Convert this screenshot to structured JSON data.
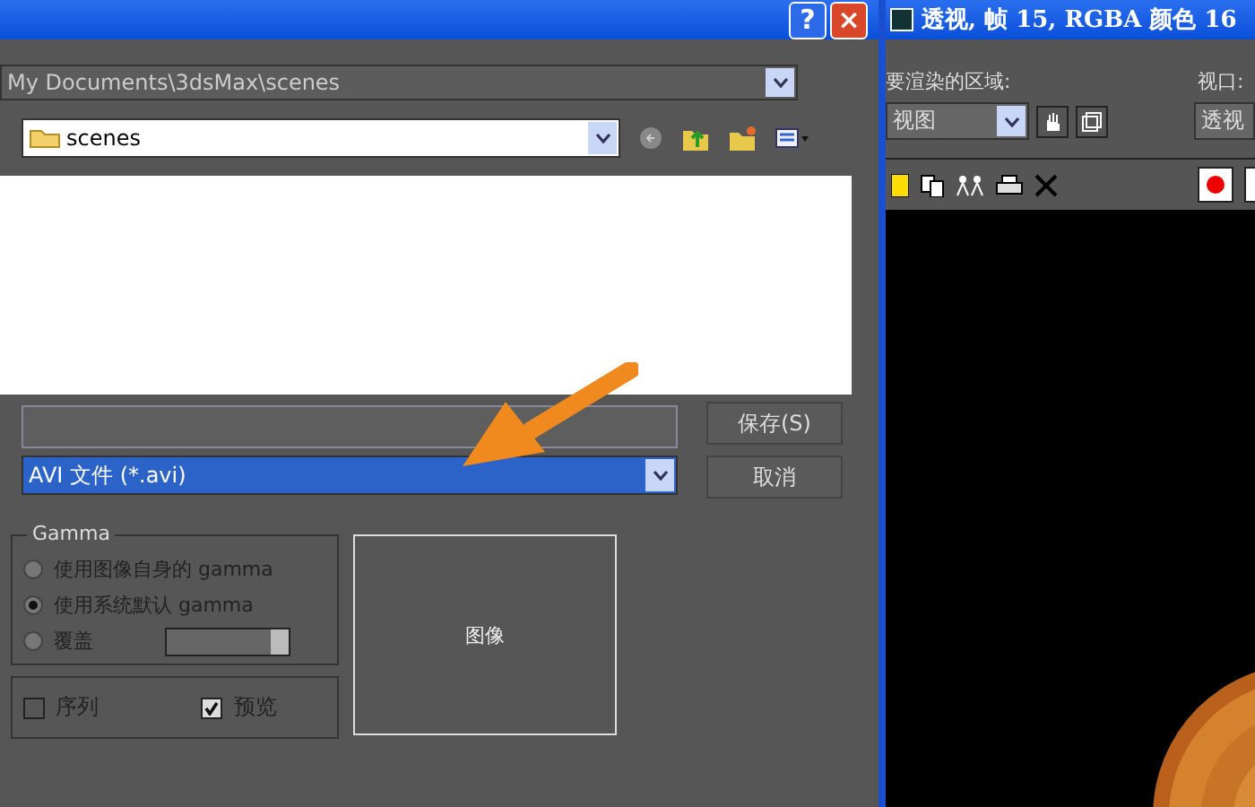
{
  "dialog": {
    "help_button": "?",
    "close_button": "×",
    "path": "My Documents\\3dsMax\\scenes",
    "folder": "scenes",
    "file_type": {
      "value": "AVI 文件 (*.avi)",
      "selected": true
    },
    "buttons": [
      "保存(S)",
      "取消"
    ],
    "gamma": {
      "title": "Gamma",
      "options": [
        {
          "label": "使用图像自身的 gamma",
          "selected": false
        },
        {
          "label": "使用系统默认 gamma",
          "selected": true
        },
        {
          "label": "覆盖",
          "selected": false
        }
      ]
    },
    "checks": [
      {
        "label": "序列",
        "checked": false
      },
      {
        "label": "预览",
        "checked": true
      }
    ],
    "preview_label": "图像"
  },
  "render_window": {
    "title": "透视, 帧 15, RGBA 颜色 16",
    "area_label": "要渲染的区域:",
    "area_value": "视图",
    "viewport_label": "视口:",
    "viewport_value": "透视"
  }
}
